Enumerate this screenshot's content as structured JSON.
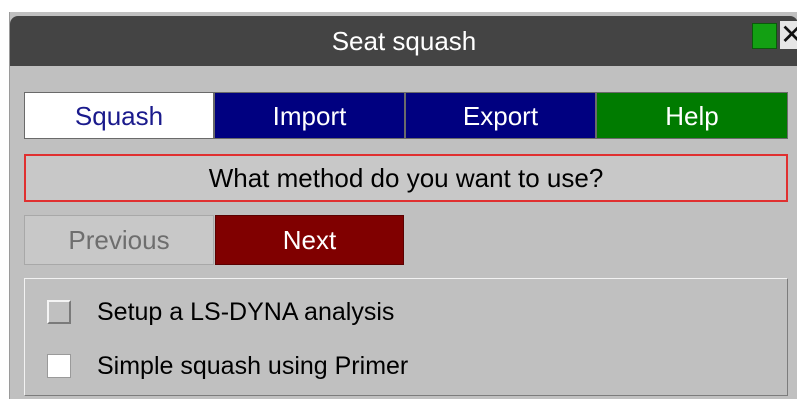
{
  "window": {
    "title": "Seat squash",
    "close_glyph": "✕",
    "icons": [
      "green-square-icon",
      "close-icon"
    ]
  },
  "tabs": [
    {
      "label": "Squash",
      "selected": true
    },
    {
      "label": "Import",
      "selected": false
    },
    {
      "label": "Export",
      "selected": false
    },
    {
      "label": "Help",
      "selected": false
    }
  ],
  "prompt": {
    "text": "What method do you want to use?"
  },
  "nav": {
    "previous_label": "Previous",
    "previous_enabled": false,
    "next_label": "Next"
  },
  "options": [
    {
      "label": "Setup a LS-DYNA analysis",
      "checked": false
    },
    {
      "label": "Simple squash using Primer",
      "checked": false
    }
  ],
  "colors": {
    "titlebar": "#444444",
    "tab_selected": "#ffffff",
    "tab_blue": "#000080",
    "tab_help": "#007b00",
    "next_button": "#800000",
    "prompt_border": "#e03030",
    "panel": "#c0c0c0"
  }
}
